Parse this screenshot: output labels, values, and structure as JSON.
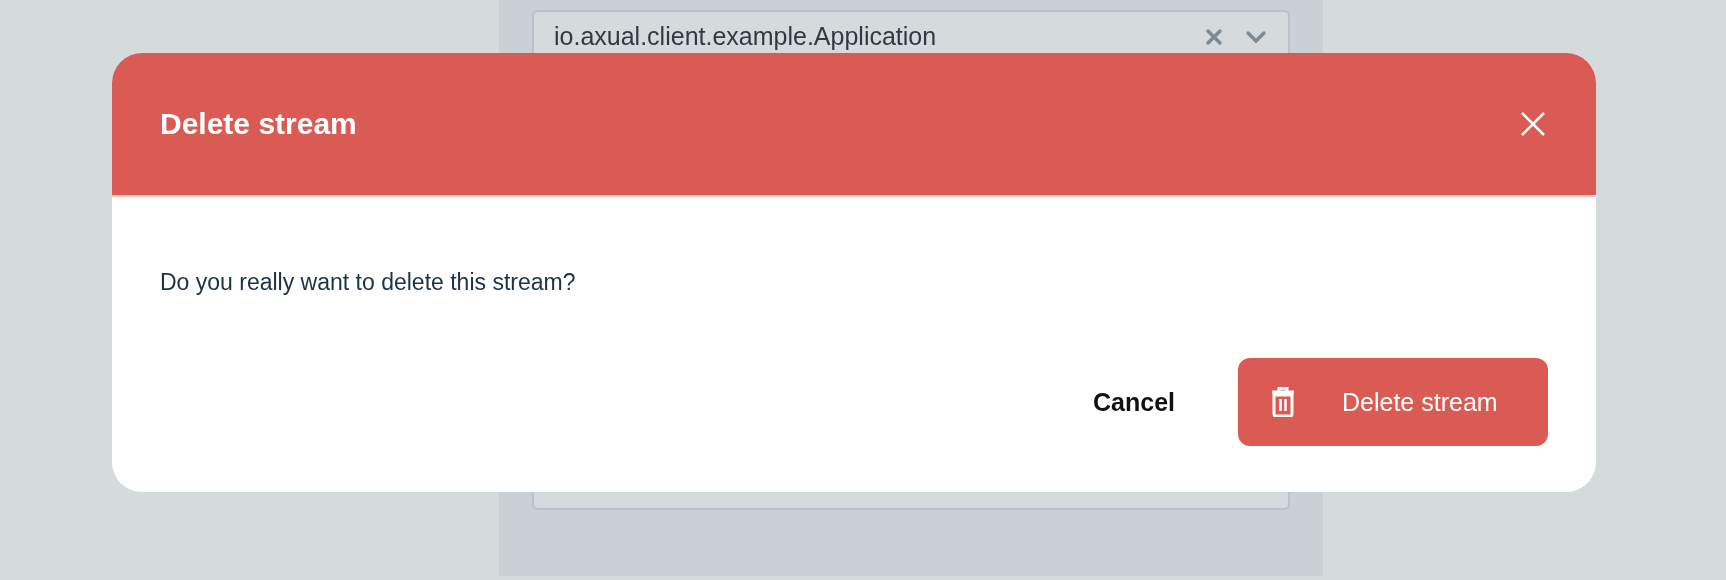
{
  "background": {
    "field": {
      "value": "io.axual.client.example.Application"
    }
  },
  "dialog": {
    "title": "Delete stream",
    "message": "Do you really want to delete this stream?",
    "buttons": [
      {
        "label": "Cancel",
        "kind": "text"
      },
      {
        "label": "Delete stream",
        "kind": "danger"
      }
    ]
  }
}
